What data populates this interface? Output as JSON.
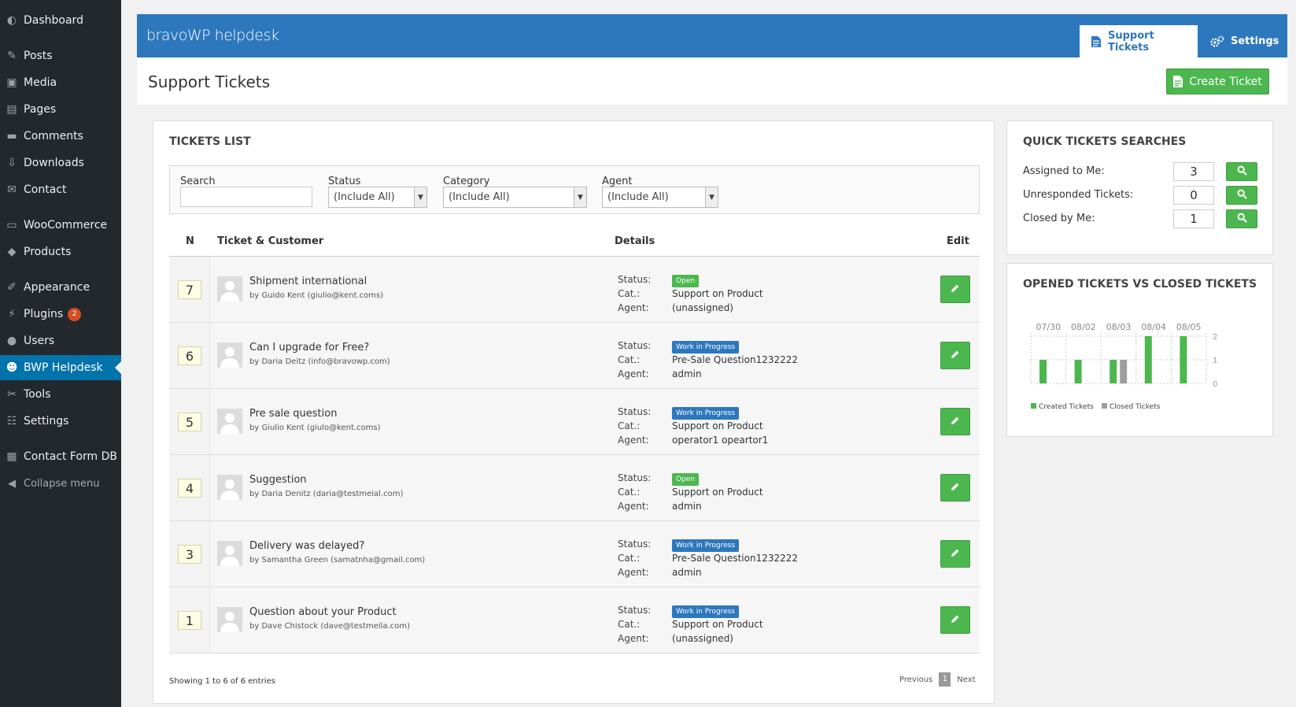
{
  "sidebar": {
    "items": [
      {
        "label": "Dashboard",
        "icon": "dashboard-icon",
        "glyph": "◐"
      },
      {
        "label": "Posts",
        "icon": "pin-icon",
        "glyph": "✎"
      },
      {
        "label": "Media",
        "icon": "media-icon",
        "glyph": "▣"
      },
      {
        "label": "Pages",
        "icon": "pages-icon",
        "glyph": "▤"
      },
      {
        "label": "Comments",
        "icon": "comment-icon",
        "glyph": "▬"
      },
      {
        "label": "Downloads",
        "icon": "download-icon",
        "glyph": "⇩"
      },
      {
        "label": "Contact",
        "icon": "mail-icon",
        "glyph": "✉"
      },
      {
        "label": "WooCommerce",
        "icon": "woo-icon",
        "glyph": "▭"
      },
      {
        "label": "Products",
        "icon": "box-icon",
        "glyph": "◆"
      },
      {
        "label": "Appearance",
        "icon": "brush-icon",
        "glyph": "✐"
      },
      {
        "label": "Plugins",
        "icon": "plug-icon",
        "glyph": "⚡",
        "badge": "2"
      },
      {
        "label": "Users",
        "icon": "user-icon",
        "glyph": "●"
      },
      {
        "label": "BWP Helpdesk",
        "icon": "helpdesk-icon",
        "glyph": "☻",
        "active": true
      },
      {
        "label": "Tools",
        "icon": "wrench-icon",
        "glyph": "✂"
      },
      {
        "label": "Settings",
        "icon": "sliders-icon",
        "glyph": "☷"
      },
      {
        "label": "Contact Form DB",
        "icon": "database-icon",
        "glyph": "▦"
      },
      {
        "label": "Collapse menu",
        "icon": "collapse-icon",
        "glyph": "◀",
        "collapse": true
      }
    ]
  },
  "header": {
    "logo": "bravoWP helpdesk",
    "tab_tickets": "Support Tickets",
    "tab_settings": "Settings"
  },
  "page": {
    "title": "Support Tickets",
    "create_button": "Create Ticket"
  },
  "tickets_panel": {
    "title": "TICKETS LIST",
    "filters": {
      "search_label": "Search",
      "search_value": "",
      "status_label": "Status",
      "status_value": "(Include All)",
      "category_label": "Category",
      "category_value": "(Include All)",
      "agent_label": "Agent",
      "agent_value": "(Include All)"
    },
    "columns": {
      "n": "N",
      "ticket": "Ticket & Customer",
      "details": "Details",
      "edit": "Edit"
    },
    "detail_labels": {
      "status": "Status:",
      "cat": "Cat.:",
      "agent": "Agent:"
    },
    "rows": [
      {
        "n": "7",
        "subject": "Shipment international",
        "by": "by Guido Kent (giulio@kent.coms)",
        "status": "Open",
        "category": "Support on Product",
        "agent": "(unassigned)"
      },
      {
        "n": "6",
        "subject": "Can I upgrade for Free?",
        "by": "by Daria Deitz (info@bravowp.com)",
        "status": "Work in Progress",
        "category": "Pre-Sale Question1232222",
        "agent": "admin"
      },
      {
        "n": "5",
        "subject": "Pre sale question",
        "by": "by Giulio Kent (giulo@kent.coms)",
        "status": "Work in Progress",
        "category": "Support on Product",
        "agent": "operator1 opeartor1"
      },
      {
        "n": "4",
        "subject": "Suggestion",
        "by": "by Daria Denitz (daria@testmeial.com)",
        "status": "Open",
        "category": "Support on Product",
        "agent": "admin"
      },
      {
        "n": "3",
        "subject": "Delivery was delayed?",
        "by": "by Samantha Green (samatnha@gmail.com)",
        "status": "Work in Progress",
        "category": "Pre-Sale Question1232222",
        "agent": "admin"
      },
      {
        "n": "1",
        "subject": "Question about your Product",
        "by": "by Dave Chistock (dave@testmeila.com)",
        "status": "Work in Progress",
        "category": "Support on Product",
        "agent": "(unassigned)"
      }
    ],
    "footer_info": "Showing 1 to 6 of 6 entries",
    "pager": {
      "previous": "Previous",
      "page": "1",
      "next": "Next"
    }
  },
  "quick_searches": {
    "title": "QUICK TICKETS SEARCHES",
    "items": [
      {
        "label": "Assigned to Me:",
        "value": "3"
      },
      {
        "label": "Unresponded Tickets:",
        "value": "0"
      },
      {
        "label": "Closed by Me:",
        "value": "1"
      }
    ]
  },
  "colors": {
    "accent": "#2d77bd",
    "green": "#4cb74f",
    "open": "#4cb74f",
    "wip": "#2d77bd",
    "created": "#4cb74f",
    "closed": "#9e9e9e"
  },
  "chart_data": {
    "type": "bar",
    "title": "OPENED TICKETS VS CLOSED TICKETS",
    "categories": [
      "07/30",
      "08/02",
      "08/03",
      "08/04",
      "08/05"
    ],
    "series": [
      {
        "name": "Created Tickets",
        "values": [
          1,
          1,
          1,
          2,
          2
        ]
      },
      {
        "name": "Closed Tickets",
        "values": [
          0,
          0,
          1,
          0,
          0
        ]
      }
    ],
    "yticks": [
      2,
      1,
      0
    ],
    "ylim": [
      0,
      2
    ],
    "legend": "bottom-left"
  }
}
